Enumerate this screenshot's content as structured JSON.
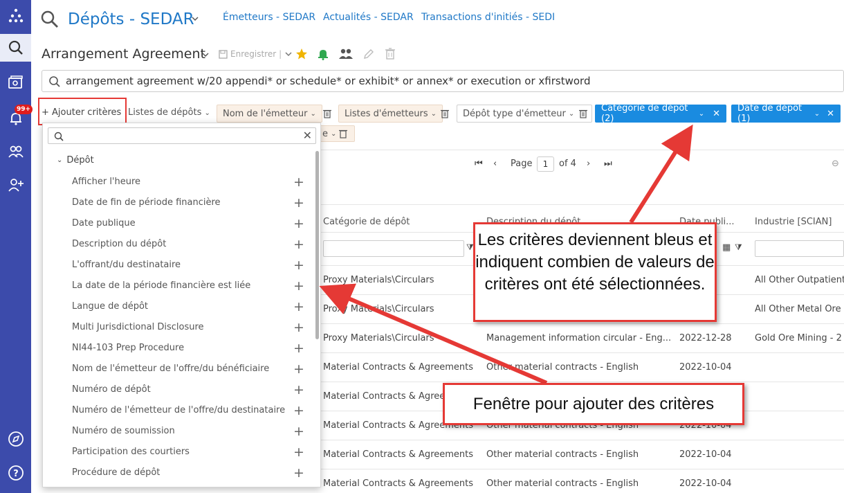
{
  "header": {
    "title": "Dépôts - SEDAR",
    "links": [
      "Émetteurs - SEDAR",
      "Actualités - SEDAR",
      "Transactions d'initiés - SEDI"
    ]
  },
  "rail": {
    "notification_badge": "99+"
  },
  "search": {
    "name": "Arrangement Agreement",
    "save_label": "Enregistrer",
    "query": "arrangement agreement w/20 appendi* or schedule* or exhibit* or annex* or execution or xfirstword"
  },
  "filters": {
    "add_label": "Ajouter critères",
    "listes_depots": "Listes de dépôts",
    "nom_emetteur": "Nom de l'émetteur",
    "listes_emetteurs": "Listes d'émetteurs",
    "depot_type": "Dépôt type d'émetteur",
    "categorie": "Catégorie de dépôt (2)",
    "date_depot": "Date de dépôt (1)",
    "wrapped_tail": "e"
  },
  "pager": {
    "page_label": "Page",
    "page": "1",
    "of_label": "of 4"
  },
  "table": {
    "headers": [
      "Catégorie de dépôt",
      "Description du dépôt",
      "Date publi...",
      "Industrie [SCIAN]"
    ],
    "rows": [
      [
        "Proxy Materials\\Circulars",
        "",
        "...27",
        "All Other Outpatient"
      ],
      [
        "Proxy Materials\\Circulars",
        "",
        "...24",
        "All Other Metal Ore I"
      ],
      [
        "Proxy Materials\\Circulars",
        "Management information circular - Eng...",
        "2022-12-28",
        "Gold Ore Mining - 2"
      ],
      [
        "Material Contracts & Agreements",
        "Other material contracts - English",
        "2022-10-04",
        ""
      ],
      [
        "Material Contracts & Agree",
        "",
        "",
        ""
      ],
      [
        "Material Contracts & Agreements",
        "Other material contracts - English",
        "2022-10-04",
        ""
      ],
      [
        "Material Contracts & Agreements",
        "Other material contracts - English",
        "2022-10-04",
        ""
      ],
      [
        "Material Contracts & Agreements",
        "Other material contracts - English",
        "2022-10-04",
        ""
      ]
    ]
  },
  "criteria_panel": {
    "group": "Dépôt",
    "items": [
      "Afficher l'heure",
      "Date de fin de période financière",
      "Date publique",
      "Description du dépôt",
      "L'offrant/du destinataire",
      "La date de la période financière est liée",
      "Langue de dépôt",
      "Multi Jurisdictional Disclosure",
      "NI44-103 Prep Procedure",
      "Nom de l'émetteur de l'offre/du bénéficiaire",
      "Numéro de dépôt",
      "Numéro de l'émetteur de l'offre/du destinataire",
      "Numéro de soumission",
      "Participation des courtiers",
      "Procédure de dépôt"
    ]
  },
  "callouts": {
    "top": "Les critères deviennent bleus et indiquent combien de valeurs de critères ont été sélectionnées.",
    "bottom": "Fenêtre pour ajouter des critères"
  },
  "colors": {
    "rail": "#3c4bab",
    "accent": "#1f78c7",
    "chip_blue": "#1a8be0",
    "callout_red": "#e53935"
  }
}
